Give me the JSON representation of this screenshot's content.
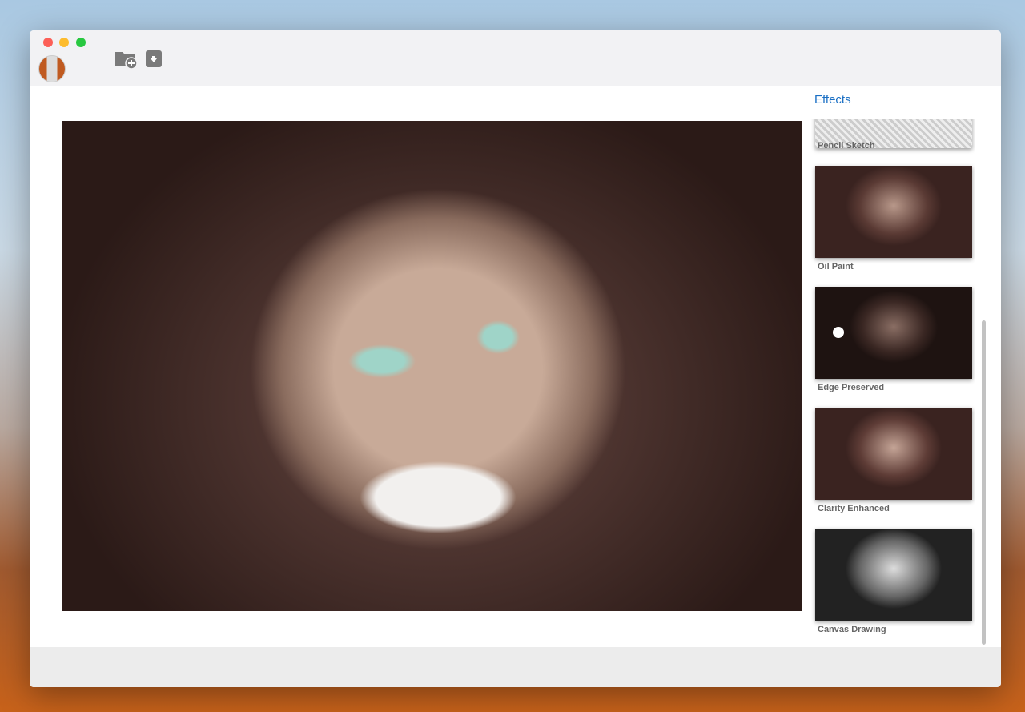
{
  "window": {
    "traffic_lights": {
      "close": "#fc5f57",
      "minimize": "#fdbc2e",
      "zoom": "#28c840"
    }
  },
  "toolbar": {
    "icons": [
      "add-folder-icon",
      "archive-download-icon"
    ]
  },
  "sidebar": {
    "title": "Effects",
    "accent": "#1a6fc4",
    "effects": [
      {
        "label": "Pencil Sketch"
      },
      {
        "label": "Oil Paint"
      },
      {
        "label": "Edge Preserved"
      },
      {
        "label": "Clarity Enhanced"
      },
      {
        "label": "Canvas Drawing"
      }
    ]
  }
}
